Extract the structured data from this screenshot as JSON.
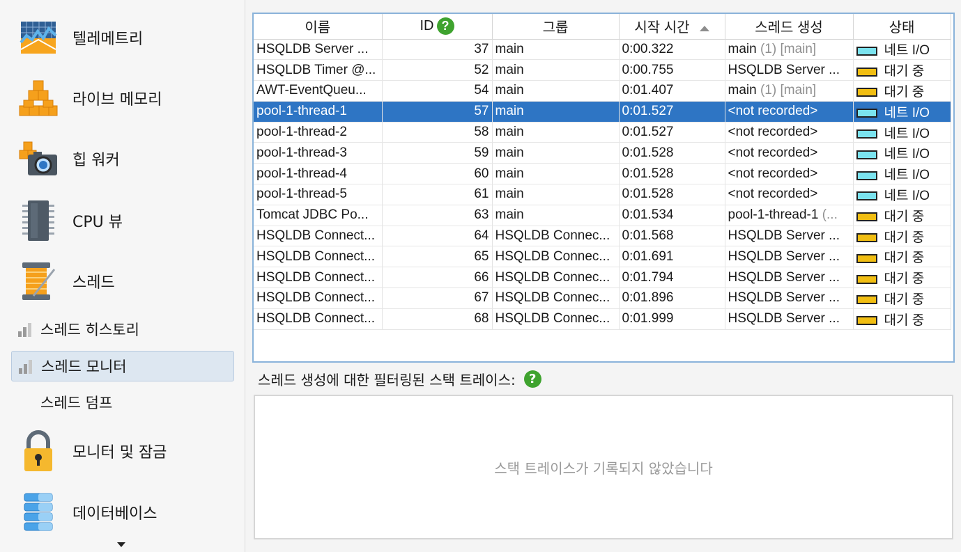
{
  "sidebar": {
    "items": [
      {
        "label": "텔레메트리",
        "icon": "telemetry-icon"
      },
      {
        "label": "라이브 메모리",
        "icon": "live-memory-icon"
      },
      {
        "label": "힙 워커",
        "icon": "heap-walker-icon"
      },
      {
        "label": "CPU 뷰",
        "icon": "cpu-chip-icon"
      },
      {
        "label": "스레드",
        "icon": "thread-spool-icon"
      }
    ],
    "sub_items": [
      {
        "label": "스레드 히스토리"
      },
      {
        "label": "스레드 모니터",
        "active": true
      },
      {
        "label": "스레드 덤프"
      }
    ],
    "items_bottom": [
      {
        "label": "모니터 및 잠금",
        "icon": "padlock-icon"
      },
      {
        "label": "데이터베이스",
        "icon": "database-icon"
      }
    ]
  },
  "table": {
    "columns": [
      "이름",
      "ID",
      "그룹",
      "시작 시간",
      "스레드 생성",
      "상태"
    ],
    "sorted_column": "시작 시간",
    "rows": [
      {
        "name": "HSQLDB Server ...",
        "id": "37",
        "group": "main",
        "start": "0:00.322",
        "creator": "main",
        "creator_extra": " (1) [main]",
        "state": "네트 I/O",
        "state_kind": "io"
      },
      {
        "name": "HSQLDB Timer @...",
        "id": "52",
        "group": "main",
        "start": "0:00.755",
        "creator": "HSQLDB Server ...",
        "creator_extra": "",
        "state": "대기 중",
        "state_kind": "wait"
      },
      {
        "name": "AWT-EventQueu...",
        "id": "54",
        "group": "main",
        "start": "0:01.407",
        "creator": "main",
        "creator_extra": " (1) [main]",
        "state": "대기 중",
        "state_kind": "wait"
      },
      {
        "name": "pool-1-thread-1",
        "id": "57",
        "group": "main",
        "start": "0:01.527",
        "creator": "<not recorded>",
        "creator_extra": "",
        "state": "네트 I/O",
        "state_kind": "io",
        "selected": true
      },
      {
        "name": "pool-1-thread-2",
        "id": "58",
        "group": "main",
        "start": "0:01.527",
        "creator": "<not recorded>",
        "creator_extra": "",
        "state": "네트 I/O",
        "state_kind": "io"
      },
      {
        "name": "pool-1-thread-3",
        "id": "59",
        "group": "main",
        "start": "0:01.528",
        "creator": "<not recorded>",
        "creator_extra": "",
        "state": "네트 I/O",
        "state_kind": "io"
      },
      {
        "name": "pool-1-thread-4",
        "id": "60",
        "group": "main",
        "start": "0:01.528",
        "creator": "<not recorded>",
        "creator_extra": "",
        "state": "네트 I/O",
        "state_kind": "io"
      },
      {
        "name": "pool-1-thread-5",
        "id": "61",
        "group": "main",
        "start": "0:01.528",
        "creator": "<not recorded>",
        "creator_extra": "",
        "state": "네트 I/O",
        "state_kind": "io"
      },
      {
        "name": "Tomcat JDBC Po...",
        "id": "63",
        "group": "main",
        "start": "0:01.534",
        "creator": "pool-1-thread-1",
        "creator_extra": " (...",
        "state": "대기 중",
        "state_kind": "wait"
      },
      {
        "name": "HSQLDB Connect...",
        "id": "64",
        "group": "HSQLDB Connec...",
        "start": "0:01.568",
        "creator": "HSQLDB Server ...",
        "creator_extra": "",
        "state": "대기 중",
        "state_kind": "wait"
      },
      {
        "name": "HSQLDB Connect...",
        "id": "65",
        "group": "HSQLDB Connec...",
        "start": "0:01.691",
        "creator": "HSQLDB Server ...",
        "creator_extra": "",
        "state": "대기 중",
        "state_kind": "wait"
      },
      {
        "name": "HSQLDB Connect...",
        "id": "66",
        "group": "HSQLDB Connec...",
        "start": "0:01.794",
        "creator": "HSQLDB Server ...",
        "creator_extra": "",
        "state": "대기 중",
        "state_kind": "wait"
      },
      {
        "name": "HSQLDB Connect...",
        "id": "67",
        "group": "HSQLDB Connec...",
        "start": "0:01.896",
        "creator": "HSQLDB Server ...",
        "creator_extra": "",
        "state": "대기 중",
        "state_kind": "wait"
      },
      {
        "name": "HSQLDB Connect...",
        "id": "68",
        "group": "HSQLDB Connec...",
        "start": "0:01.999",
        "creator": "HSQLDB Server ...",
        "creator_extra": "",
        "state": "대기 중",
        "state_kind": "wait"
      }
    ]
  },
  "trace": {
    "label": "스레드 생성에 대한 필터링된 스택 트레이스:",
    "empty_message": "스택 트레이스가 기록되지 않았습니다"
  },
  "colors": {
    "accent": "#2e75c4",
    "io_state": "#7be3ef",
    "wait_state": "#f1be12",
    "help": "#3fa32f"
  }
}
